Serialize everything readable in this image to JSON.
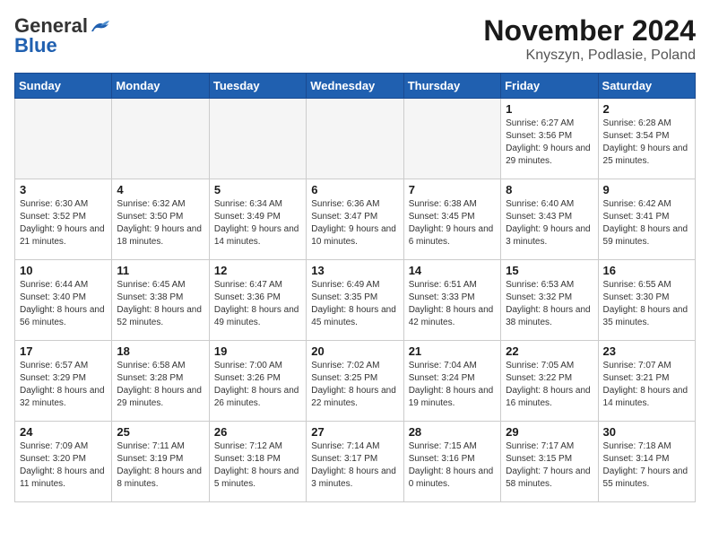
{
  "logo": {
    "general": "General",
    "blue": "Blue"
  },
  "title": "November 2024",
  "subtitle": "Knyszyn, Podlasie, Poland",
  "weekdays": [
    "Sunday",
    "Monday",
    "Tuesday",
    "Wednesday",
    "Thursday",
    "Friday",
    "Saturday"
  ],
  "weeks": [
    [
      {
        "day": null
      },
      {
        "day": null
      },
      {
        "day": null
      },
      {
        "day": null
      },
      {
        "day": null
      },
      {
        "day": "1",
        "sunrise": "Sunrise: 6:27 AM",
        "sunset": "Sunset: 3:56 PM",
        "daylight": "Daylight: 9 hours and 29 minutes."
      },
      {
        "day": "2",
        "sunrise": "Sunrise: 6:28 AM",
        "sunset": "Sunset: 3:54 PM",
        "daylight": "Daylight: 9 hours and 25 minutes."
      }
    ],
    [
      {
        "day": "3",
        "sunrise": "Sunrise: 6:30 AM",
        "sunset": "Sunset: 3:52 PM",
        "daylight": "Daylight: 9 hours and 21 minutes."
      },
      {
        "day": "4",
        "sunrise": "Sunrise: 6:32 AM",
        "sunset": "Sunset: 3:50 PM",
        "daylight": "Daylight: 9 hours and 18 minutes."
      },
      {
        "day": "5",
        "sunrise": "Sunrise: 6:34 AM",
        "sunset": "Sunset: 3:49 PM",
        "daylight": "Daylight: 9 hours and 14 minutes."
      },
      {
        "day": "6",
        "sunrise": "Sunrise: 6:36 AM",
        "sunset": "Sunset: 3:47 PM",
        "daylight": "Daylight: 9 hours and 10 minutes."
      },
      {
        "day": "7",
        "sunrise": "Sunrise: 6:38 AM",
        "sunset": "Sunset: 3:45 PM",
        "daylight": "Daylight: 9 hours and 6 minutes."
      },
      {
        "day": "8",
        "sunrise": "Sunrise: 6:40 AM",
        "sunset": "Sunset: 3:43 PM",
        "daylight": "Daylight: 9 hours and 3 minutes."
      },
      {
        "day": "9",
        "sunrise": "Sunrise: 6:42 AM",
        "sunset": "Sunset: 3:41 PM",
        "daylight": "Daylight: 8 hours and 59 minutes."
      }
    ],
    [
      {
        "day": "10",
        "sunrise": "Sunrise: 6:44 AM",
        "sunset": "Sunset: 3:40 PM",
        "daylight": "Daylight: 8 hours and 56 minutes."
      },
      {
        "day": "11",
        "sunrise": "Sunrise: 6:45 AM",
        "sunset": "Sunset: 3:38 PM",
        "daylight": "Daylight: 8 hours and 52 minutes."
      },
      {
        "day": "12",
        "sunrise": "Sunrise: 6:47 AM",
        "sunset": "Sunset: 3:36 PM",
        "daylight": "Daylight: 8 hours and 49 minutes."
      },
      {
        "day": "13",
        "sunrise": "Sunrise: 6:49 AM",
        "sunset": "Sunset: 3:35 PM",
        "daylight": "Daylight: 8 hours and 45 minutes."
      },
      {
        "day": "14",
        "sunrise": "Sunrise: 6:51 AM",
        "sunset": "Sunset: 3:33 PM",
        "daylight": "Daylight: 8 hours and 42 minutes."
      },
      {
        "day": "15",
        "sunrise": "Sunrise: 6:53 AM",
        "sunset": "Sunset: 3:32 PM",
        "daylight": "Daylight: 8 hours and 38 minutes."
      },
      {
        "day": "16",
        "sunrise": "Sunrise: 6:55 AM",
        "sunset": "Sunset: 3:30 PM",
        "daylight": "Daylight: 8 hours and 35 minutes."
      }
    ],
    [
      {
        "day": "17",
        "sunrise": "Sunrise: 6:57 AM",
        "sunset": "Sunset: 3:29 PM",
        "daylight": "Daylight: 8 hours and 32 minutes."
      },
      {
        "day": "18",
        "sunrise": "Sunrise: 6:58 AM",
        "sunset": "Sunset: 3:28 PM",
        "daylight": "Daylight: 8 hours and 29 minutes."
      },
      {
        "day": "19",
        "sunrise": "Sunrise: 7:00 AM",
        "sunset": "Sunset: 3:26 PM",
        "daylight": "Daylight: 8 hours and 26 minutes."
      },
      {
        "day": "20",
        "sunrise": "Sunrise: 7:02 AM",
        "sunset": "Sunset: 3:25 PM",
        "daylight": "Daylight: 8 hours and 22 minutes."
      },
      {
        "day": "21",
        "sunrise": "Sunrise: 7:04 AM",
        "sunset": "Sunset: 3:24 PM",
        "daylight": "Daylight: 8 hours and 19 minutes."
      },
      {
        "day": "22",
        "sunrise": "Sunrise: 7:05 AM",
        "sunset": "Sunset: 3:22 PM",
        "daylight": "Daylight: 8 hours and 16 minutes."
      },
      {
        "day": "23",
        "sunrise": "Sunrise: 7:07 AM",
        "sunset": "Sunset: 3:21 PM",
        "daylight": "Daylight: 8 hours and 14 minutes."
      }
    ],
    [
      {
        "day": "24",
        "sunrise": "Sunrise: 7:09 AM",
        "sunset": "Sunset: 3:20 PM",
        "daylight": "Daylight: 8 hours and 11 minutes."
      },
      {
        "day": "25",
        "sunrise": "Sunrise: 7:11 AM",
        "sunset": "Sunset: 3:19 PM",
        "daylight": "Daylight: 8 hours and 8 minutes."
      },
      {
        "day": "26",
        "sunrise": "Sunrise: 7:12 AM",
        "sunset": "Sunset: 3:18 PM",
        "daylight": "Daylight: 8 hours and 5 minutes."
      },
      {
        "day": "27",
        "sunrise": "Sunrise: 7:14 AM",
        "sunset": "Sunset: 3:17 PM",
        "daylight": "Daylight: 8 hours and 3 minutes."
      },
      {
        "day": "28",
        "sunrise": "Sunrise: 7:15 AM",
        "sunset": "Sunset: 3:16 PM",
        "daylight": "Daylight: 8 hours and 0 minutes."
      },
      {
        "day": "29",
        "sunrise": "Sunrise: 7:17 AM",
        "sunset": "Sunset: 3:15 PM",
        "daylight": "Daylight: 7 hours and 58 minutes."
      },
      {
        "day": "30",
        "sunrise": "Sunrise: 7:18 AM",
        "sunset": "Sunset: 3:14 PM",
        "daylight": "Daylight: 7 hours and 55 minutes."
      }
    ]
  ]
}
